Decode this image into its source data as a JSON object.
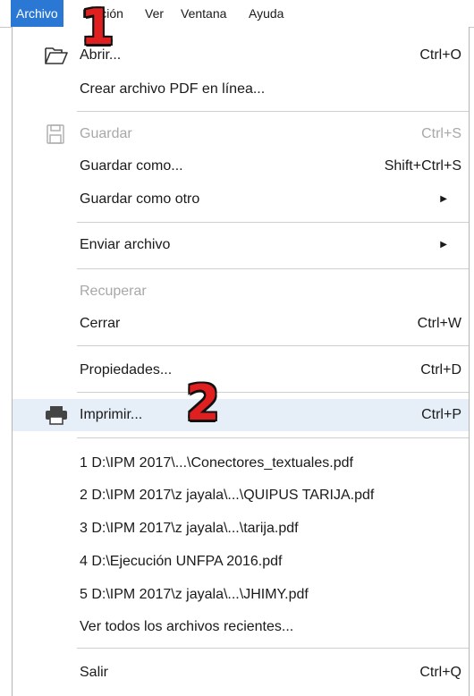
{
  "menubar": {
    "items": [
      "Archivo",
      "Edición",
      "Ver",
      "Ventana",
      "Ayuda"
    ]
  },
  "menu": {
    "open": {
      "label": "Abrir...",
      "shortcut": "Ctrl+O",
      "icon": "folder-open-icon"
    },
    "create_pdf_online": {
      "label": "Crear archivo PDF en línea..."
    },
    "save": {
      "label": "Guardar",
      "shortcut": "Ctrl+S",
      "icon": "floppy-disk-icon",
      "enabled": false
    },
    "save_as": {
      "label": "Guardar como...",
      "shortcut": "Shift+Ctrl+S"
    },
    "save_as_other": {
      "label": "Guardar como otro",
      "submenu": true
    },
    "send_file": {
      "label": "Enviar archivo",
      "submenu": true
    },
    "recover": {
      "label": "Recuperar",
      "enabled": false
    },
    "close": {
      "label": "Cerrar",
      "shortcut": "Ctrl+W"
    },
    "properties": {
      "label": "Propiedades...",
      "shortcut": "Ctrl+D"
    },
    "print": {
      "label": "Imprimir...",
      "shortcut": "Ctrl+P",
      "icon": "printer-icon",
      "highlighted": true
    },
    "recent_files": [
      "1 D:\\IPM 2017\\...\\Conectores_textuales.pdf",
      "2 D:\\IPM 2017\\z jayala\\...\\QUIPUS TARIJA.pdf",
      "3 D:\\IPM 2017\\z jayala\\...\\tarija.pdf",
      "4 D:\\Ejecución UNFPA  2016.pdf",
      "5 D:\\IPM 2017\\z jayala\\...\\JHIMY.pdf"
    ],
    "view_all_recent": {
      "label": "Ver todos los archivos recientes..."
    },
    "exit": {
      "label": "Salir",
      "shortcut": "Ctrl+Q"
    }
  },
  "annotations": {
    "step1": "1",
    "step2": "2"
  },
  "colors": {
    "menubar_active": "#2b78d4",
    "highlight_row": "#e6eef8",
    "annotation_red": "#e02020",
    "disabled_text": "#a8a8a8"
  }
}
